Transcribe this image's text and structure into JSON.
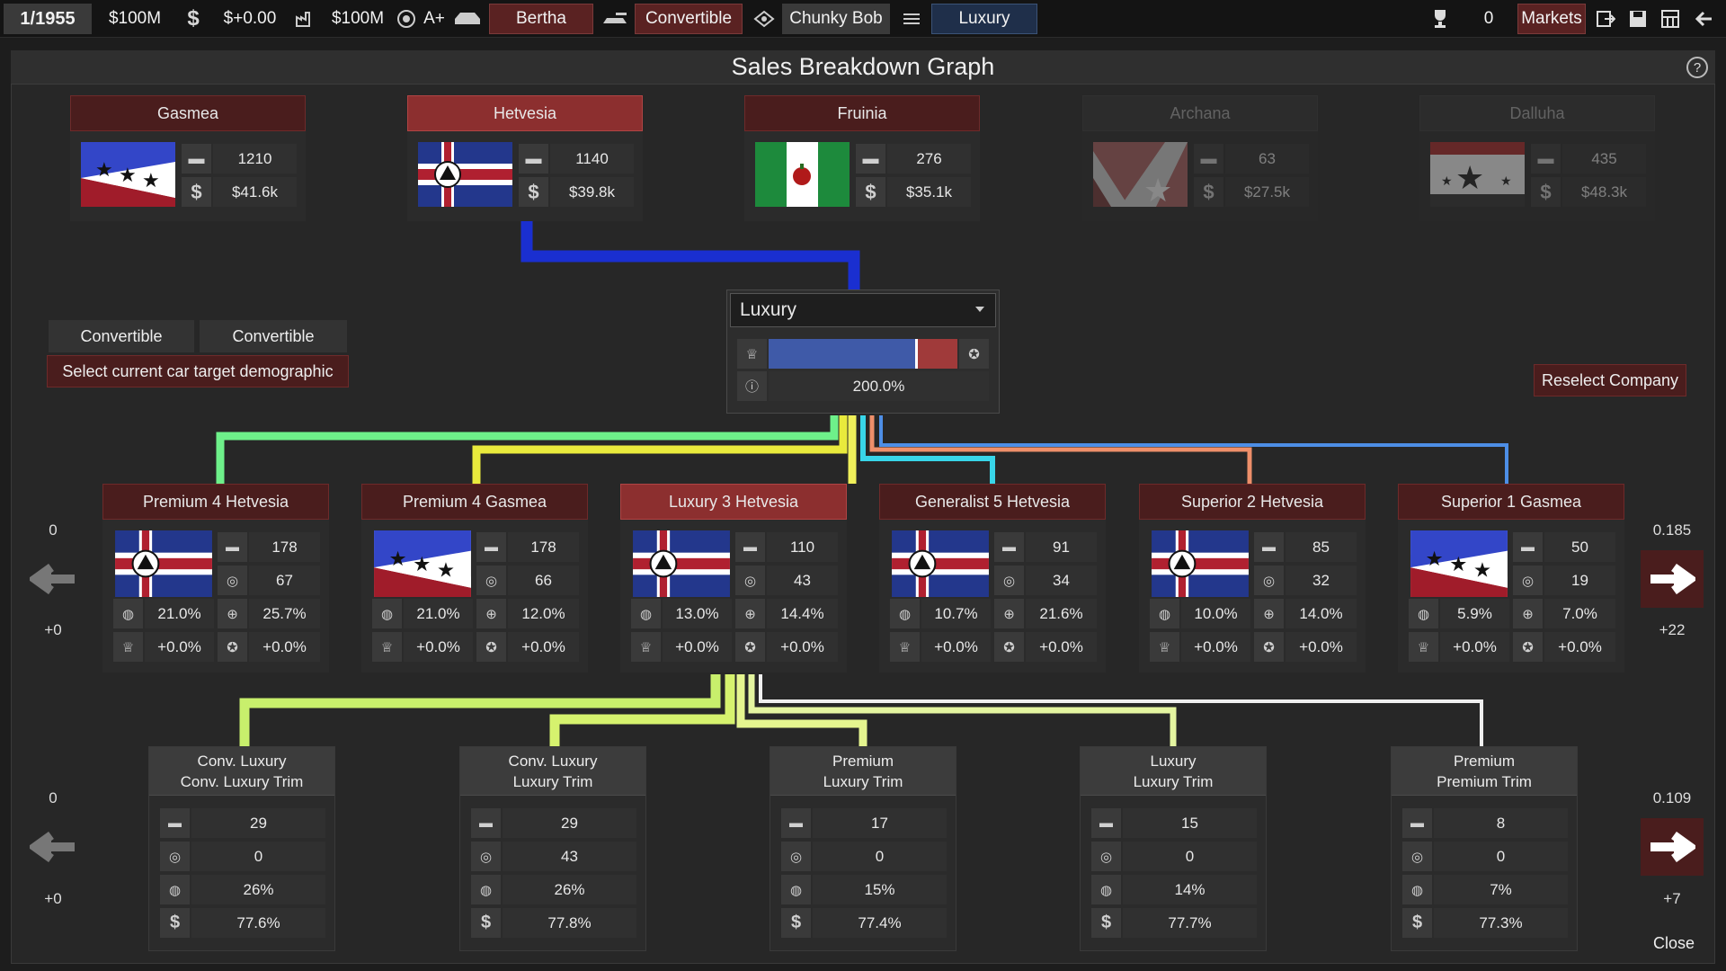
{
  "topbar": {
    "turn": "1/1955",
    "money": "$100M",
    "income": "$+0.00",
    "value": "$100M",
    "rating": "A+",
    "car": "Bertha",
    "body": "Convertible",
    "engine": "Chunky Bob",
    "trim": "Luxury",
    "trophies": "0",
    "markets": "Markets"
  },
  "title": "Sales Breakdown Graph",
  "regions": [
    {
      "name": "Gasmea",
      "units": "1210",
      "price": "$41.6k",
      "flag": "gasmea"
    },
    {
      "name": "Hetvesia",
      "units": "1140",
      "price": "$39.8k",
      "flag": "hetvesia"
    },
    {
      "name": "Fruinia",
      "units": "276",
      "price": "$35.1k",
      "flag": "fruinia"
    },
    {
      "name": "Archana",
      "units": "63",
      "price": "$27.5k",
      "flag": "archana"
    },
    {
      "name": "Dalluha",
      "units": "435",
      "price": "$48.3k",
      "flag": "dalluha"
    }
  ],
  "left_panel": {
    "tab1": "Convertible",
    "tab2": "Convertible",
    "select_label": "Select current car target demographic"
  },
  "trim_select": {
    "value": "Luxury",
    "bar_fill_fraction": 0.78,
    "percent": "200.0%"
  },
  "reselect": "Reselect Company",
  "demographics": [
    {
      "name": "Premium 4 Hetvesia",
      "flag": "hetvesia",
      "units": "178",
      "interest": "67",
      "share": "21.0%",
      "appeal": "25.7%",
      "lux": "+0.0%",
      "pres": "+0.0%"
    },
    {
      "name": "Premium 4 Gasmea",
      "flag": "gasmea",
      "units": "178",
      "interest": "66",
      "share": "21.0%",
      "appeal": "12.0%",
      "lux": "+0.0%",
      "pres": "+0.0%"
    },
    {
      "name": "Luxury 3 Hetvesia",
      "flag": "hetvesia",
      "units": "110",
      "interest": "43",
      "share": "13.0%",
      "appeal": "14.4%",
      "lux": "+0.0%",
      "pres": "+0.0%"
    },
    {
      "name": "Generalist 5 Hetvesia",
      "flag": "hetvesia",
      "units": "91",
      "interest": "34",
      "share": "10.7%",
      "appeal": "21.6%",
      "lux": "+0.0%",
      "pres": "+0.0%"
    },
    {
      "name": "Superior 2 Hetvesia",
      "flag": "hetvesia",
      "units": "85",
      "interest": "32",
      "share": "10.0%",
      "appeal": "14.0%",
      "lux": "+0.0%",
      "pres": "+0.0%"
    },
    {
      "name": "Superior 1 Gasmea",
      "flag": "gasmea",
      "units": "50",
      "interest": "19",
      "share": "5.9%",
      "appeal": "7.0%",
      "lux": "+0.0%",
      "pres": "+0.0%"
    }
  ],
  "demo_nav": {
    "left_top": "0",
    "left_bottom": "+0",
    "right_top": "0.185",
    "right_bottom": "+22"
  },
  "trims": [
    {
      "line1": "Conv. Luxury",
      "line2": "Conv. Luxury Trim",
      "units": "29",
      "interest": "0",
      "share": "26%",
      "price": "77.6%"
    },
    {
      "line1": "Conv. Luxury",
      "line2": "Luxury Trim",
      "units": "29",
      "interest": "43",
      "share": "26%",
      "price": "77.8%"
    },
    {
      "line1": "Premium",
      "line2": "Luxury Trim",
      "units": "17",
      "interest": "0",
      "share": "15%",
      "price": "77.4%"
    },
    {
      "line1": "Luxury",
      "line2": "Luxury Trim",
      "units": "15",
      "interest": "0",
      "share": "14%",
      "price": "77.7%"
    },
    {
      "line1": "Premium",
      "line2": "Premium Trim",
      "units": "8",
      "interest": "0",
      "share": "7%",
      "price": "77.3%"
    }
  ],
  "trim_nav": {
    "left_top": "0",
    "left_bottom": "+0",
    "right_top": "0.109",
    "right_bottom": "+7"
  },
  "close": "Close",
  "colors": {
    "header_red": "#4a1d1d",
    "selected_red": "#8c2f2f",
    "accent_blue": "#1f2f4a"
  }
}
